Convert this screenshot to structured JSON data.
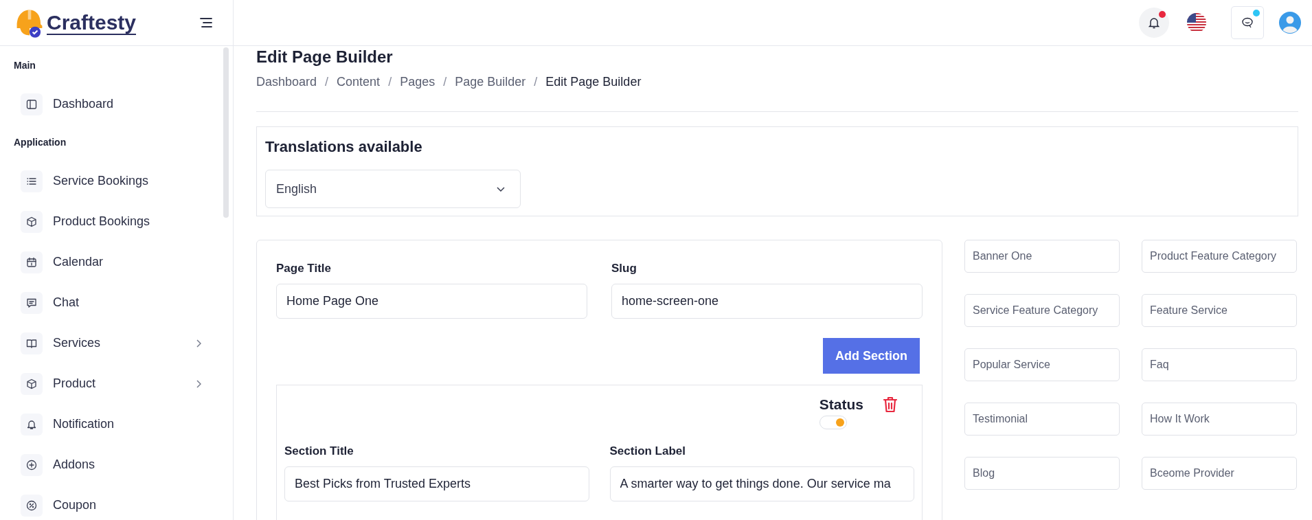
{
  "logo": {
    "text": "Craftesty"
  },
  "sidebar": {
    "sections": [
      {
        "title": "Main",
        "items": [
          {
            "label": "Dashboard",
            "kind": "panel",
            "has_submenu": false
          }
        ]
      },
      {
        "title": "Application",
        "items": [
          {
            "label": "Service Bookings",
            "kind": "list",
            "has_submenu": false
          },
          {
            "label": "Product Bookings",
            "kind": "box",
            "has_submenu": false
          },
          {
            "label": "Calendar",
            "kind": "calendar",
            "has_submenu": false
          },
          {
            "label": "Chat",
            "kind": "chat",
            "has_submenu": false
          },
          {
            "label": "Services",
            "kind": "book",
            "has_submenu": true
          },
          {
            "label": "Product",
            "kind": "box",
            "has_submenu": true
          },
          {
            "label": "Notification",
            "kind": "bell",
            "has_submenu": false
          },
          {
            "label": "Addons",
            "kind": "plus",
            "has_submenu": false
          },
          {
            "label": "Coupon",
            "kind": "percent",
            "has_submenu": false
          }
        ]
      }
    ]
  },
  "topbar": {
    "notifications_unread": true,
    "messages_unread": true
  },
  "page": {
    "title": "Edit Page Builder",
    "separator": "/",
    "breadcrumb": [
      {
        "label": "Dashboard",
        "current": false
      },
      {
        "label": "Content",
        "current": false
      },
      {
        "label": "Pages",
        "current": false
      },
      {
        "label": "Page Builder",
        "current": false
      },
      {
        "label": "Edit Page Builder",
        "current": true
      }
    ]
  },
  "translations": {
    "heading": "Translations available",
    "language": "English"
  },
  "form": {
    "fields": [
      {
        "label": "Page Title",
        "value": "Home Page One"
      },
      {
        "label": "Slug",
        "value": "home-screen-one"
      }
    ],
    "add_button": "Add Section",
    "section": {
      "status_label": "Status",
      "status_on": true,
      "fields": [
        {
          "label": "Section Title",
          "value": "Best Picks from Trusted Experts"
        },
        {
          "label": "Section Label",
          "value": "A smarter way to get things done. Our service ma"
        }
      ]
    }
  },
  "section_types": [
    "Banner One",
    "Product Feature Category",
    "Service Feature Category",
    "Feature Service",
    "Popular Service",
    "Faq",
    "Testimonial",
    "How It Work",
    "Blog",
    "Bceome Provider"
  ]
}
